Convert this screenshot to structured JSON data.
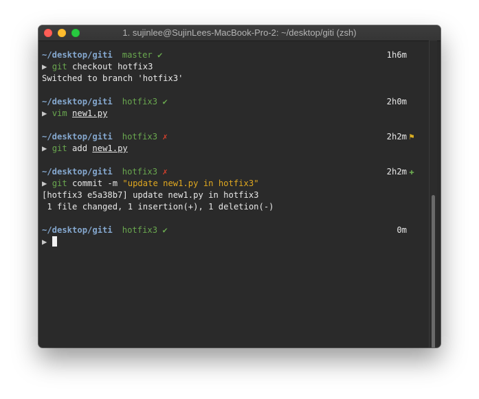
{
  "window": {
    "title": "1. sujinlee@SujinLees-MacBook-Pro-2: ~/desktop/giti (zsh)"
  },
  "prompts": [
    {
      "path": "~/desktop/giti",
      "branch": "master",
      "status": "✔",
      "time": "1h6m",
      "time_icon": ""
    },
    {
      "path": "~/desktop/giti",
      "branch": "hotfix3",
      "status": "✔",
      "time": "2h0m",
      "time_icon": ""
    },
    {
      "path": "~/desktop/giti",
      "branch": "hotfix3",
      "status": "✗",
      "time": "2h2m",
      "time_icon": "⚑"
    },
    {
      "path": "~/desktop/giti",
      "branch": "hotfix3",
      "status": "✗",
      "time": "2h2m",
      "time_icon": "✚"
    },
    {
      "path": "~/desktop/giti",
      "branch": "hotfix3",
      "status": "✔",
      "time": "0m",
      "time_icon": ""
    }
  ],
  "arrow": "▶",
  "commands": {
    "c1": {
      "cmd": "git",
      "rest": " checkout hotfix3"
    },
    "c2": {
      "cmd": "vim",
      "file": "new1.py"
    },
    "c3": {
      "cmd": "git",
      "rest": " add ",
      "file": "new1.py"
    },
    "c4": {
      "cmd": "git",
      "rest": " commit -m ",
      "msg": "\"update new1.py in hotfix3\""
    }
  },
  "output": {
    "o1": "Switched to branch 'hotfix3'",
    "o2": "[hotfix3 e5a38b7] update new1.py in hotfix3",
    "o3": " 1 file changed, 1 insertion(+), 1 deletion(-)"
  },
  "colors": {
    "path": "#85a8cf",
    "branch": "#6aa84f",
    "error": "#d7402c",
    "string": "#e0a820",
    "background": "#2a2a2a"
  }
}
